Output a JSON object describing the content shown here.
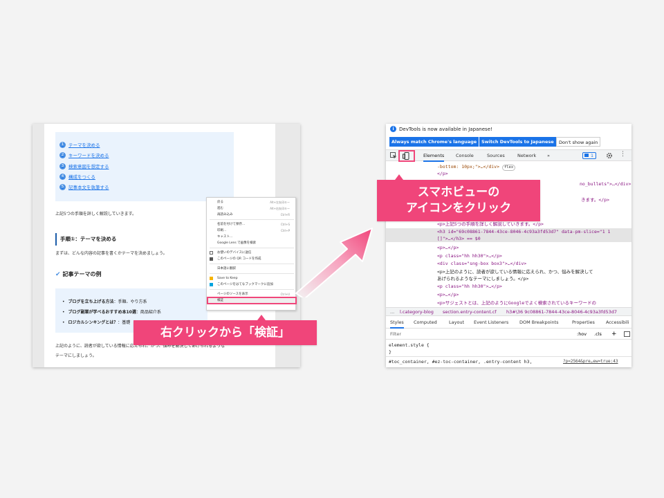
{
  "left_article": {
    "toc": [
      {
        "num": "1",
        "label": "テーマを決める"
      },
      {
        "num": "2",
        "label": "キーワードを決める"
      },
      {
        "num": "3",
        "label": "検索意図を想定する"
      },
      {
        "num": "4",
        "label": "構成をつくる"
      },
      {
        "num": "5",
        "label": "記事本文を執筆する"
      }
    ],
    "intro": "上記5つの手順を詳しく解説していきます。",
    "step_heading": "手順①：テーマを決める",
    "step_text": "まずは、どんな内容の記事を書くかテーマを決めましょう。",
    "example_heading": "記事テーマの例",
    "examples": [
      {
        "bold": "ブログを立ち上げる方法",
        "rest": "：手順、やり方系"
      },
      {
        "bold": "ブログ副業が学べるおすすめ本10選",
        "rest": "：商品紹介系"
      },
      {
        "bold": "ロジカルシンキングとは？",
        "rest": "：基礎"
      }
    ],
    "closing_1": "上記のように、読者が欲している情報に応えられ、かつ、悩みを解決してあげられるような",
    "closing_2": "テーマにしましょう。"
  },
  "context_menu": {
    "items": [
      {
        "label": "戻る",
        "shortcut": "Alt+左矢印キー"
      },
      {
        "label": "進む",
        "shortcut": "Alt+右矢印キー"
      },
      {
        "label": "再読み込み",
        "shortcut": "Ctrl+R"
      },
      {
        "label": "名前を付けて保存...",
        "shortcut": "Ctrl+S"
      },
      {
        "label": "印刷...",
        "shortcut": "Ctrl+P"
      },
      {
        "label": "キャスト...",
        "shortcut": ""
      },
      {
        "label": "Google Lens で画像を検索",
        "shortcut": ""
      },
      {
        "label": "お使いのデバイスに送信",
        "shortcut": ""
      },
      {
        "label": "このページの QR コードを作成",
        "shortcut": ""
      },
      {
        "label": "日本語に翻訳",
        "shortcut": ""
      },
      {
        "label": "Save to Keep",
        "shortcut": ""
      },
      {
        "label": "このページをはてなブックマークに追加",
        "shortcut": ""
      },
      {
        "label": "ページのソースを表示",
        "shortcut": "Ctrl+U"
      },
      {
        "label": "検証",
        "shortcut": ""
      }
    ]
  },
  "callouts": {
    "left": "右クリックから「検証」",
    "right_line1": "スマホビューの",
    "right_line2": "アイコンをクリック"
  },
  "devtools": {
    "info_text": "DevTools is now available in Japanese!",
    "btn_match": "Always match Chrome's language",
    "btn_switch": "Switch DevTools to Japanese",
    "btn_dismiss": "Don't show again",
    "tabs": [
      "Elements",
      "Console",
      "Sources",
      "Network"
    ],
    "more_tabs": "»",
    "issues_count": "1",
    "code_lines": [
      "-bottom: 10px;\">…</div>",
      "</p>",
      "no_bullets\">…</div>",
      "きます。</p>",
      "<p>上記5つの手順を詳しく解説していきます。</p>",
      "<h3 id=\"69c08861-7844-43ce-8046-4c93a3fd53d7\" data-pm-slice=\"1 1",
      "[]\">…</h3> == $0",
      "<p>…</p>",
      "<p class=\"hh hh30\">…</p>",
      "<div class=\"sng-box box3\">…</div>",
      "<p>上記のように、読者が欲している情報に応えられ、かつ、悩みを解決して",
      "あげられるようなテーマにしましょう。</p>",
      "<p class=\"hh hh30\">…</p>",
      "<p>…</p>",
      "<p>サジェストとは、上記のようにGoogleでよく検索されているキーワードの"
    ],
    "flex_pill": "flex",
    "crumbs": [
      "...",
      "l.category-blog",
      "section.entry-content.cf",
      "h3#\\36 9c08861-7844-43ce-8046-4c93a3fd53d7"
    ],
    "subtabs": [
      "Styles",
      "Computed",
      "Layout",
      "Event Listeners",
      "DOM Breakpoints",
      "Properties",
      "Accessibili"
    ],
    "filter_placeholder": "Filter",
    "hov": ":hov",
    "cls": ".cls",
    "plus": "+",
    "element_style": "element.style {",
    "close_brace": "}",
    "rule_selector": "#toc_container, #ez-toc-container, .entry-content h3,",
    "rule_link": "?p=2564&pre…ew=true:43"
  },
  "colors": {
    "accent_pink": "#f0457a",
    "chrome_blue": "#1a73e8"
  }
}
